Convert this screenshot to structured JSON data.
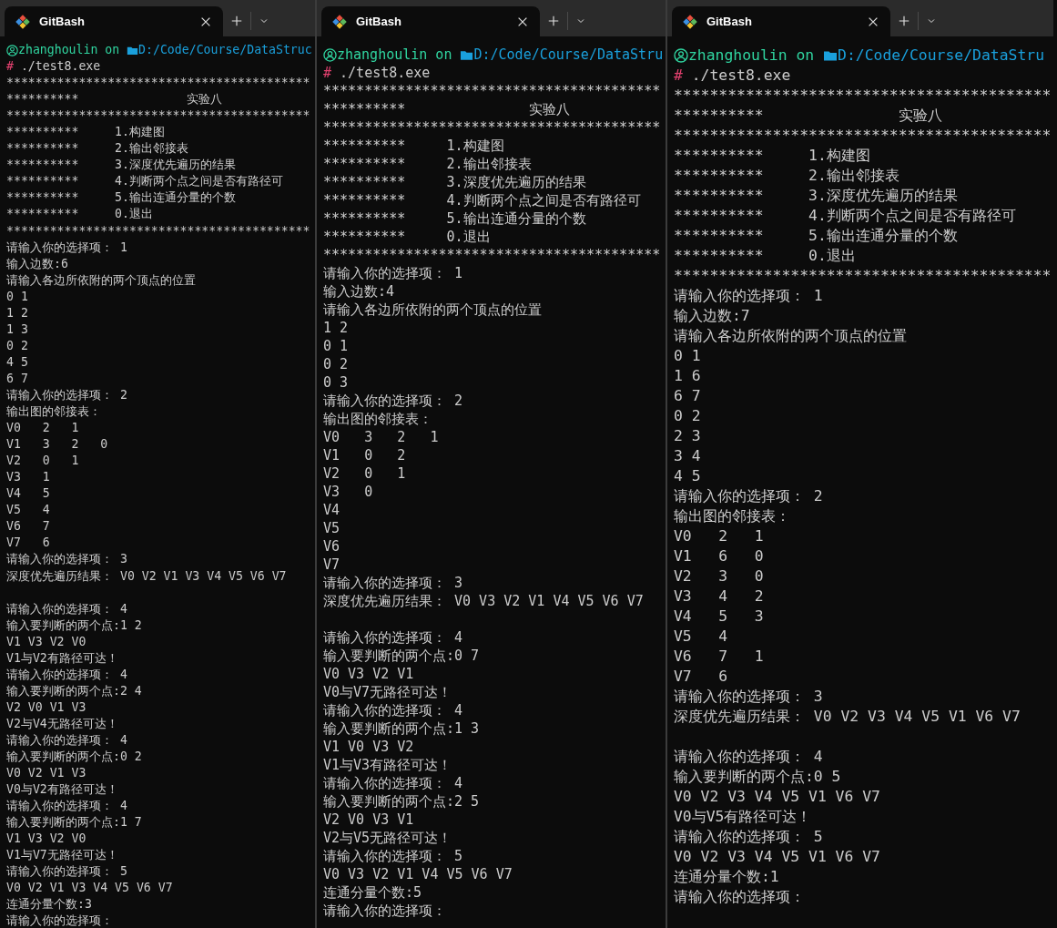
{
  "windows": [
    {
      "tab": {
        "title": "GitBash",
        "selected": true
      },
      "prompt": {
        "user": "zhanghoulin",
        "on": "on",
        "path": "D:/Code/Course/DataStruc"
      },
      "command": {
        "symbol": "#",
        "text": "./test8.exe"
      },
      "blocks": [
        [
          "******************************************",
          "**********               实验八",
          "******************************************",
          "**********     1.构建图",
          "**********     2.输出邻接表",
          "**********     3.深度优先遍历的结果",
          "**********     4.判断两个点之间是否有路径可",
          "**********     5.输出连通分量的个数",
          "**********     0.退出",
          "******************************************",
          "请输入你的选择项： 1",
          "输入边数:6",
          "请输入各边所依附的两个顶点的位置",
          "0 1",
          "1 2",
          "1 3",
          "0 2",
          "4 5",
          "6 7",
          "请输入你的选择项： 2",
          "输出图的邻接表：",
          "V0   2   1",
          "V1   3   2   0",
          "V2   0   1",
          "V3   1",
          "V4   5",
          "V5   4",
          "V6   7",
          "V7   6",
          "请输入你的选择项： 3",
          "深度优先遍历结果： V0 V2 V1 V3 V4 V5 V6 V7"
        ],
        [
          "请输入你的选择项： 4",
          "输入要判断的两个点:1 2",
          "V1 V3 V2 V0",
          "V1与V2有路径可达！",
          "请输入你的选择项： 4",
          "输入要判断的两个点:2 4",
          "V2 V0 V1 V3",
          "V2与V4无路径可达！",
          "请输入你的选择项： 4",
          "输入要判断的两个点:0 2",
          "V0 V2 V1 V3",
          "V0与V2有路径可达！",
          "请输入你的选择项： 4",
          "输入要判断的两个点:1 7",
          "V1 V3 V2 V0",
          "V1与V7无路径可达！",
          "请输入你的选择项： 5",
          "V0 V2 V1 V3 V4 V5 V6 V7",
          "连通分量个数:3",
          "请输入你的选择项："
        ]
      ]
    },
    {
      "tab": {
        "title": "GitBash",
        "selected": true
      },
      "prompt": {
        "user": "zhanghoulin",
        "on": "on",
        "path": "D:/Code/Course/DataStru"
      },
      "command": {
        "symbol": "#",
        "text": "./test8.exe"
      },
      "blocks": [
        [
          "*****************************************",
          "**********               实验八",
          "*****************************************",
          "**********     1.构建图",
          "**********     2.输出邻接表",
          "**********     3.深度优先遍历的结果",
          "**********     4.判断两个点之间是否有路径可",
          "**********     5.输出连通分量的个数",
          "**********     0.退出",
          "*****************************************",
          "请输入你的选择项： 1",
          "输入边数:4",
          "请输入各边所依附的两个顶点的位置",
          "1 2",
          "0 1",
          "0 2",
          "0 3",
          "请输入你的选择项： 2",
          "输出图的邻接表：",
          "V0   3   2   1",
          "V1   0   2",
          "V2   0   1",
          "V3   0",
          "V4",
          "V5",
          "V6",
          "V7",
          "请输入你的选择项： 3",
          "深度优先遍历结果： V0 V3 V2 V1 V4 V5 V6 V7"
        ],
        [
          "请输入你的选择项： 4",
          "输入要判断的两个点:0 7",
          "V0 V3 V2 V1",
          "V0与V7无路径可达！",
          "请输入你的选择项： 4",
          "输入要判断的两个点:1 3",
          "V1 V0 V3 V2",
          "V1与V3有路径可达！",
          "请输入你的选择项： 4",
          "输入要判断的两个点:2 5",
          "V2 V0 V3 V1",
          "V2与V5无路径可达！",
          "请输入你的选择项： 5",
          "V0 V3 V2 V1 V4 V5 V6 V7",
          "连通分量个数:5",
          "请输入你的选择项："
        ]
      ]
    },
    {
      "tab": {
        "title": "GitBash",
        "selected": true
      },
      "prompt": {
        "user": "zhanghoulin",
        "on": "on",
        "path": "D:/Code/Course/DataStru"
      },
      "command": {
        "symbol": "#",
        "text": "./test8.exe"
      },
      "blocks": [
        [
          "******************************************",
          "**********               实验八",
          "******************************************",
          "**********     1.构建图",
          "**********     2.输出邻接表",
          "**********     3.深度优先遍历的结果",
          "**********     4.判断两个点之间是否有路径可",
          "**********     5.输出连通分量的个数",
          "**********     0.退出",
          "******************************************",
          "请输入你的选择项： 1",
          "输入边数:7",
          "请输入各边所依附的两个顶点的位置",
          "0 1",
          "1 6",
          "6 7",
          "0 2",
          "2 3",
          "3 4",
          "4 5",
          "请输入你的选择项： 2",
          "输出图的邻接表：",
          "V0   2   1",
          "V1   6   0",
          "V2   3   0",
          "V3   4   2",
          "V4   5   3",
          "V5   4",
          "V6   7   1",
          "V7   6",
          "请输入你的选择项： 3",
          "深度优先遍历结果： V0 V2 V3 V4 V5 V1 V6 V7"
        ],
        [
          "请输入你的选择项： 4",
          "输入要判断的两个点:0 5",
          "V0 V2 V3 V4 V5 V1 V6 V7",
          "V0与V5有路径可达！",
          "请输入你的选择项： 5",
          "V0 V2 V3 V4 V5 V1 V6 V7",
          "连通分量个数:1",
          "请输入你的选择项："
        ]
      ]
    }
  ]
}
